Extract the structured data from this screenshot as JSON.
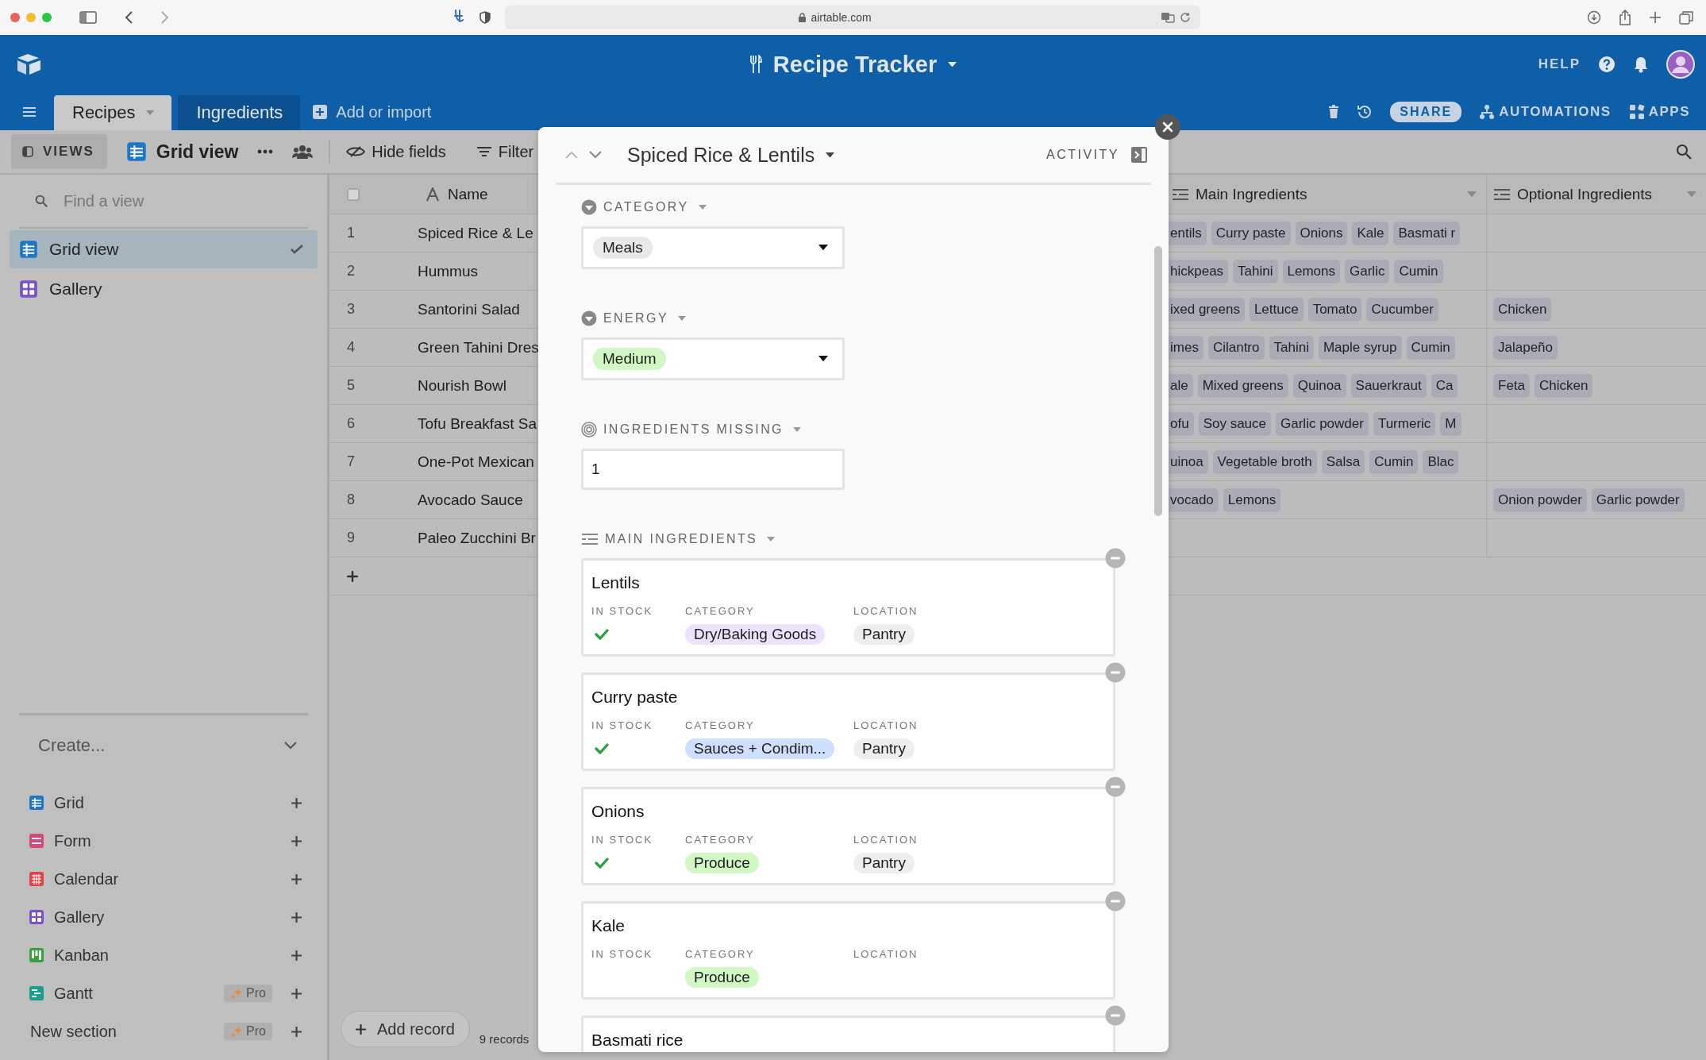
{
  "browser": {
    "url": "airtable.com"
  },
  "base": {
    "title": "Recipe Tracker",
    "help": "HELP"
  },
  "tables": [
    {
      "label": "Recipes",
      "selected": true
    },
    {
      "label": "Ingredients",
      "selected": false
    }
  ],
  "add_table": "Add or import",
  "actions": {
    "share": "SHARE",
    "automations": "AUTOMATIONS",
    "apps": "APPS"
  },
  "toolbar": {
    "views": "VIEWS",
    "view_name": "Grid view",
    "hide_fields": "Hide fields",
    "filter": "Filter"
  },
  "sidebar": {
    "search": {
      "placeholder": "Find a view"
    },
    "views": [
      {
        "label": "Grid view",
        "kind": "grid",
        "selected": true
      },
      {
        "label": "Gallery",
        "kind": "gallery",
        "selected": false
      }
    ],
    "create": {
      "title": "Create...",
      "items": [
        {
          "label": "Grid",
          "kind": "grid"
        },
        {
          "label": "Form",
          "kind": "form"
        },
        {
          "label": "Calendar",
          "kind": "calendar"
        },
        {
          "label": "Gallery",
          "kind": "gallery"
        },
        {
          "label": "Kanban",
          "kind": "kanban"
        },
        {
          "label": "Gantt",
          "kind": "gantt",
          "badge": "Pro"
        },
        {
          "label": "New section",
          "kind": "section",
          "badge": "Pro"
        }
      ]
    }
  },
  "grid": {
    "name_column": "Name",
    "columns": [
      "Main Ingredients",
      "Optional Ingredients"
    ],
    "rows": [
      {
        "number": "1",
        "name": "Spiced Rice & Le",
        "main": [
          "entils",
          "Curry paste",
          "Onions",
          "Kale",
          "Basmati r"
        ],
        "optional": []
      },
      {
        "number": "2",
        "name": "Hummus",
        "main": [
          "hickpeas",
          "Tahini",
          "Lemons",
          "Garlic",
          "Cumin"
        ],
        "optional": []
      },
      {
        "number": "3",
        "name": "Santorini Salad",
        "main": [
          "ixed greens",
          "Lettuce",
          "Tomato",
          "Cucumber"
        ],
        "optional": [
          "Chicken"
        ]
      },
      {
        "number": "4",
        "name": "Green Tahini Dres",
        "main": [
          "imes",
          "Cilantro",
          "Tahini",
          "Maple syrup",
          "Cumin"
        ],
        "optional": [
          "Jalapeño"
        ]
      },
      {
        "number": "5",
        "name": "Nourish Bowl",
        "main": [
          "ale",
          "Mixed greens",
          "Quinoa",
          "Sauerkraut",
          "Ca"
        ],
        "optional": [
          "Feta",
          "Chicken"
        ]
      },
      {
        "number": "6",
        "name": "Tofu Breakfast Sa",
        "main": [
          "ofu",
          "Soy sauce",
          "Garlic powder",
          "Turmeric",
          "M"
        ],
        "optional": []
      },
      {
        "number": "7",
        "name": "One-Pot Mexican",
        "main": [
          "uinoa",
          "Vegetable broth",
          "Salsa",
          "Cumin",
          "Blac"
        ],
        "optional": []
      },
      {
        "number": "8",
        "name": "Avocado Sauce",
        "main": [
          "vocado",
          "Lemons"
        ],
        "optional": [
          "Onion powder",
          "Garlic powder"
        ]
      },
      {
        "number": "9",
        "name": "Paleo Zucchini Br",
        "main": [],
        "optional": []
      }
    ],
    "add_record": "Add record",
    "count": "9 records"
  },
  "record": {
    "title": "Spiced Rice & Lentils",
    "activity": "ACTIVITY",
    "fields": [
      {
        "kind": "select",
        "label": "CATEGORY",
        "value": "Meals",
        "color": "#e9e9e9"
      },
      {
        "kind": "select",
        "label": "ENERGY",
        "value": "Medium",
        "color": "#d1f7c4"
      },
      {
        "kind": "number",
        "label": "INGREDIENTS MISSING",
        "value": "1"
      },
      {
        "kind": "links",
        "label": "MAIN INGREDIENTS",
        "records": [
          {
            "title": "Lentils",
            "fields": [
              {
                "kind": "check",
                "label": "IN STOCK",
                "checked": true
              },
              {
                "kind": "tag",
                "label": "CATEGORY",
                "value": "Dry/Baking Goods",
                "color": "#ede2fe"
              },
              {
                "kind": "tag",
                "label": "LOCATION",
                "value": "Pantry",
                "color": "#eeeeee"
              }
            ]
          },
          {
            "title": "Curry paste",
            "fields": [
              {
                "kind": "check",
                "label": "IN STOCK",
                "checked": true
              },
              {
                "kind": "tag",
                "label": "CATEGORY",
                "value": "Sauces + Condim...",
                "color": "#cfdfff"
              },
              {
                "kind": "tag",
                "label": "LOCATION",
                "value": "Pantry",
                "color": "#eeeeee"
              }
            ]
          },
          {
            "title": "Onions",
            "fields": [
              {
                "kind": "check",
                "label": "IN STOCK",
                "checked": true
              },
              {
                "kind": "tag",
                "label": "CATEGORY",
                "value": "Produce",
                "color": "#d1f7c4"
              },
              {
                "kind": "tag",
                "label": "LOCATION",
                "value": "Pantry",
                "color": "#eeeeee"
              }
            ]
          },
          {
            "title": "Kale",
            "fields": [
              {
                "kind": "check",
                "label": "IN STOCK",
                "checked": false
              },
              {
                "kind": "tag",
                "label": "CATEGORY",
                "value": "Produce",
                "color": "#d1f7c4"
              },
              {
                "kind": "tag",
                "label": "LOCATION"
              }
            ]
          },
          {
            "title": "Basmati rice"
          }
        ]
      }
    ]
  }
}
